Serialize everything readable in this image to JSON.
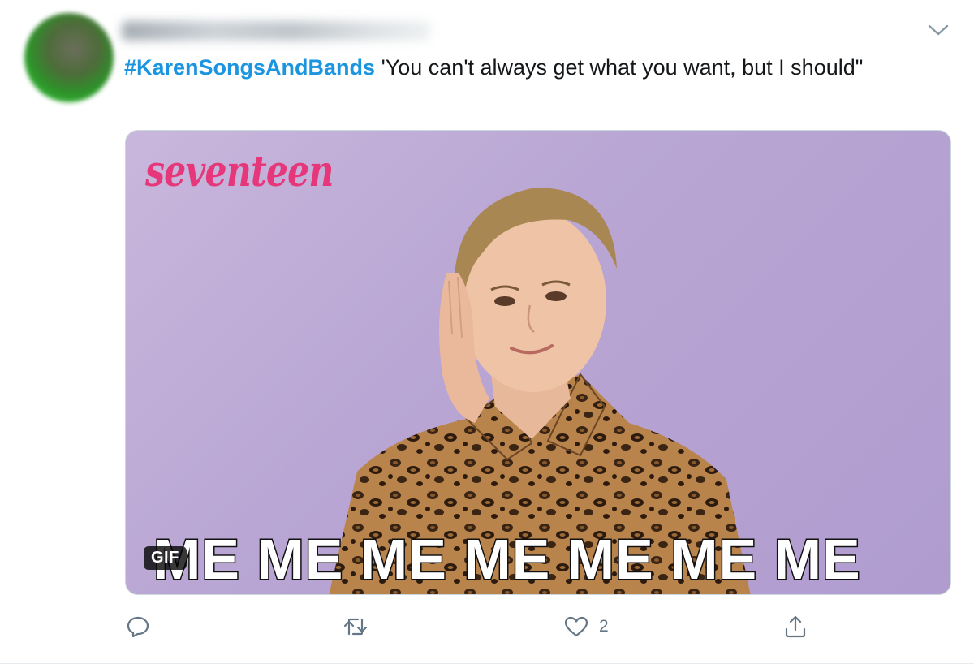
{
  "tweet": {
    "hashtag": "#KarenSongsAndBands",
    "text": " 'You can't always get what you want, but I should\""
  },
  "media": {
    "brand": "seventeen",
    "caption": "ME ME ME ME ME ME ME",
    "badge": "GIF"
  },
  "actions": {
    "like_count": "2"
  },
  "icons": {
    "menu": "chevron-down-icon",
    "reply": "reply-icon",
    "retweet": "retweet-icon",
    "like": "heart-icon",
    "share": "share-icon"
  },
  "colors": {
    "hashtag": "#1b95e0",
    "action_gray": "#657786",
    "brand_pink": "#e6377a",
    "media_bg": "#b9a6d4"
  }
}
